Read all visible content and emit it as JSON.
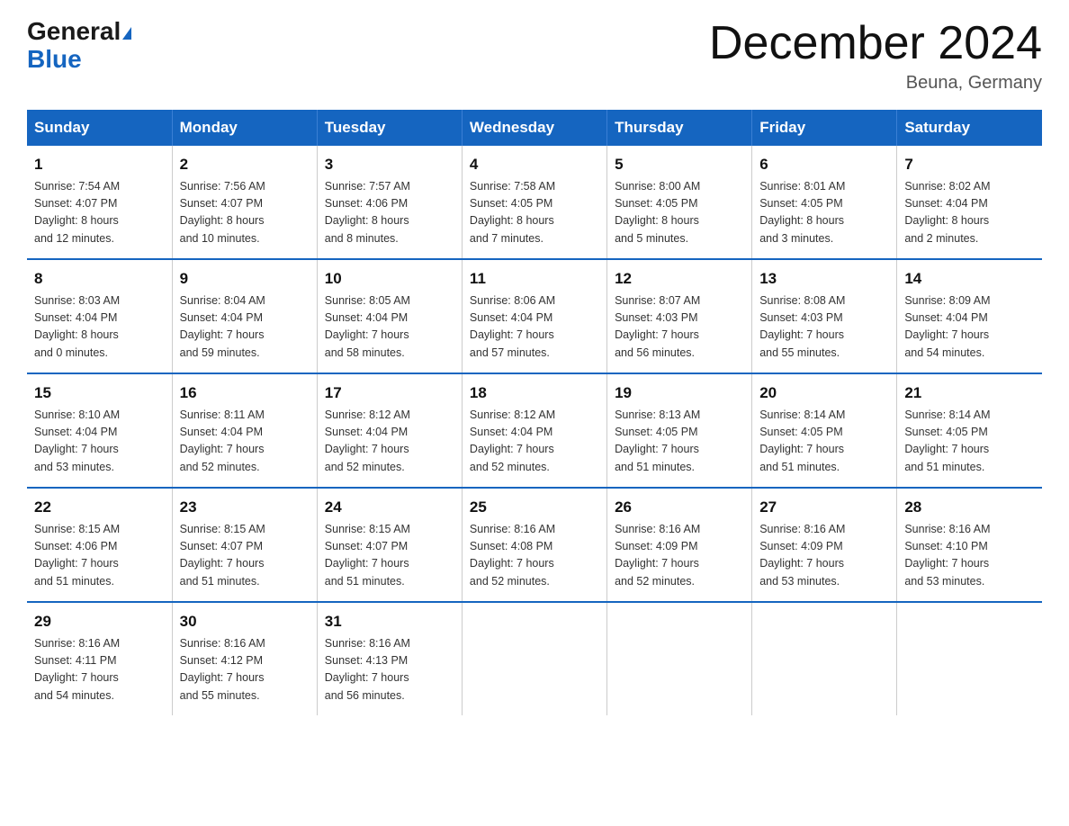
{
  "logo": {
    "part1": "General",
    "part2": "Blue"
  },
  "title": "December 2024",
  "subtitle": "Beuna, Germany",
  "days_header": [
    "Sunday",
    "Monday",
    "Tuesday",
    "Wednesday",
    "Thursday",
    "Friday",
    "Saturday"
  ],
  "weeks": [
    [
      {
        "num": "1",
        "lines": [
          "Sunrise: 7:54 AM",
          "Sunset: 4:07 PM",
          "Daylight: 8 hours",
          "and 12 minutes."
        ]
      },
      {
        "num": "2",
        "lines": [
          "Sunrise: 7:56 AM",
          "Sunset: 4:07 PM",
          "Daylight: 8 hours",
          "and 10 minutes."
        ]
      },
      {
        "num": "3",
        "lines": [
          "Sunrise: 7:57 AM",
          "Sunset: 4:06 PM",
          "Daylight: 8 hours",
          "and 8 minutes."
        ]
      },
      {
        "num": "4",
        "lines": [
          "Sunrise: 7:58 AM",
          "Sunset: 4:05 PM",
          "Daylight: 8 hours",
          "and 7 minutes."
        ]
      },
      {
        "num": "5",
        "lines": [
          "Sunrise: 8:00 AM",
          "Sunset: 4:05 PM",
          "Daylight: 8 hours",
          "and 5 minutes."
        ]
      },
      {
        "num": "6",
        "lines": [
          "Sunrise: 8:01 AM",
          "Sunset: 4:05 PM",
          "Daylight: 8 hours",
          "and 3 minutes."
        ]
      },
      {
        "num": "7",
        "lines": [
          "Sunrise: 8:02 AM",
          "Sunset: 4:04 PM",
          "Daylight: 8 hours",
          "and 2 minutes."
        ]
      }
    ],
    [
      {
        "num": "8",
        "lines": [
          "Sunrise: 8:03 AM",
          "Sunset: 4:04 PM",
          "Daylight: 8 hours",
          "and 0 minutes."
        ]
      },
      {
        "num": "9",
        "lines": [
          "Sunrise: 8:04 AM",
          "Sunset: 4:04 PM",
          "Daylight: 7 hours",
          "and 59 minutes."
        ]
      },
      {
        "num": "10",
        "lines": [
          "Sunrise: 8:05 AM",
          "Sunset: 4:04 PM",
          "Daylight: 7 hours",
          "and 58 minutes."
        ]
      },
      {
        "num": "11",
        "lines": [
          "Sunrise: 8:06 AM",
          "Sunset: 4:04 PM",
          "Daylight: 7 hours",
          "and 57 minutes."
        ]
      },
      {
        "num": "12",
        "lines": [
          "Sunrise: 8:07 AM",
          "Sunset: 4:03 PM",
          "Daylight: 7 hours",
          "and 56 minutes."
        ]
      },
      {
        "num": "13",
        "lines": [
          "Sunrise: 8:08 AM",
          "Sunset: 4:03 PM",
          "Daylight: 7 hours",
          "and 55 minutes."
        ]
      },
      {
        "num": "14",
        "lines": [
          "Sunrise: 8:09 AM",
          "Sunset: 4:04 PM",
          "Daylight: 7 hours",
          "and 54 minutes."
        ]
      }
    ],
    [
      {
        "num": "15",
        "lines": [
          "Sunrise: 8:10 AM",
          "Sunset: 4:04 PM",
          "Daylight: 7 hours",
          "and 53 minutes."
        ]
      },
      {
        "num": "16",
        "lines": [
          "Sunrise: 8:11 AM",
          "Sunset: 4:04 PM",
          "Daylight: 7 hours",
          "and 52 minutes."
        ]
      },
      {
        "num": "17",
        "lines": [
          "Sunrise: 8:12 AM",
          "Sunset: 4:04 PM",
          "Daylight: 7 hours",
          "and 52 minutes."
        ]
      },
      {
        "num": "18",
        "lines": [
          "Sunrise: 8:12 AM",
          "Sunset: 4:04 PM",
          "Daylight: 7 hours",
          "and 52 minutes."
        ]
      },
      {
        "num": "19",
        "lines": [
          "Sunrise: 8:13 AM",
          "Sunset: 4:05 PM",
          "Daylight: 7 hours",
          "and 51 minutes."
        ]
      },
      {
        "num": "20",
        "lines": [
          "Sunrise: 8:14 AM",
          "Sunset: 4:05 PM",
          "Daylight: 7 hours",
          "and 51 minutes."
        ]
      },
      {
        "num": "21",
        "lines": [
          "Sunrise: 8:14 AM",
          "Sunset: 4:05 PM",
          "Daylight: 7 hours",
          "and 51 minutes."
        ]
      }
    ],
    [
      {
        "num": "22",
        "lines": [
          "Sunrise: 8:15 AM",
          "Sunset: 4:06 PM",
          "Daylight: 7 hours",
          "and 51 minutes."
        ]
      },
      {
        "num": "23",
        "lines": [
          "Sunrise: 8:15 AM",
          "Sunset: 4:07 PM",
          "Daylight: 7 hours",
          "and 51 minutes."
        ]
      },
      {
        "num": "24",
        "lines": [
          "Sunrise: 8:15 AM",
          "Sunset: 4:07 PM",
          "Daylight: 7 hours",
          "and 51 minutes."
        ]
      },
      {
        "num": "25",
        "lines": [
          "Sunrise: 8:16 AM",
          "Sunset: 4:08 PM",
          "Daylight: 7 hours",
          "and 52 minutes."
        ]
      },
      {
        "num": "26",
        "lines": [
          "Sunrise: 8:16 AM",
          "Sunset: 4:09 PM",
          "Daylight: 7 hours",
          "and 52 minutes."
        ]
      },
      {
        "num": "27",
        "lines": [
          "Sunrise: 8:16 AM",
          "Sunset: 4:09 PM",
          "Daylight: 7 hours",
          "and 53 minutes."
        ]
      },
      {
        "num": "28",
        "lines": [
          "Sunrise: 8:16 AM",
          "Sunset: 4:10 PM",
          "Daylight: 7 hours",
          "and 53 minutes."
        ]
      }
    ],
    [
      {
        "num": "29",
        "lines": [
          "Sunrise: 8:16 AM",
          "Sunset: 4:11 PM",
          "Daylight: 7 hours",
          "and 54 minutes."
        ]
      },
      {
        "num": "30",
        "lines": [
          "Sunrise: 8:16 AM",
          "Sunset: 4:12 PM",
          "Daylight: 7 hours",
          "and 55 minutes."
        ]
      },
      {
        "num": "31",
        "lines": [
          "Sunrise: 8:16 AM",
          "Sunset: 4:13 PM",
          "Daylight: 7 hours",
          "and 56 minutes."
        ]
      },
      {
        "num": "",
        "lines": []
      },
      {
        "num": "",
        "lines": []
      },
      {
        "num": "",
        "lines": []
      },
      {
        "num": "",
        "lines": []
      }
    ]
  ]
}
